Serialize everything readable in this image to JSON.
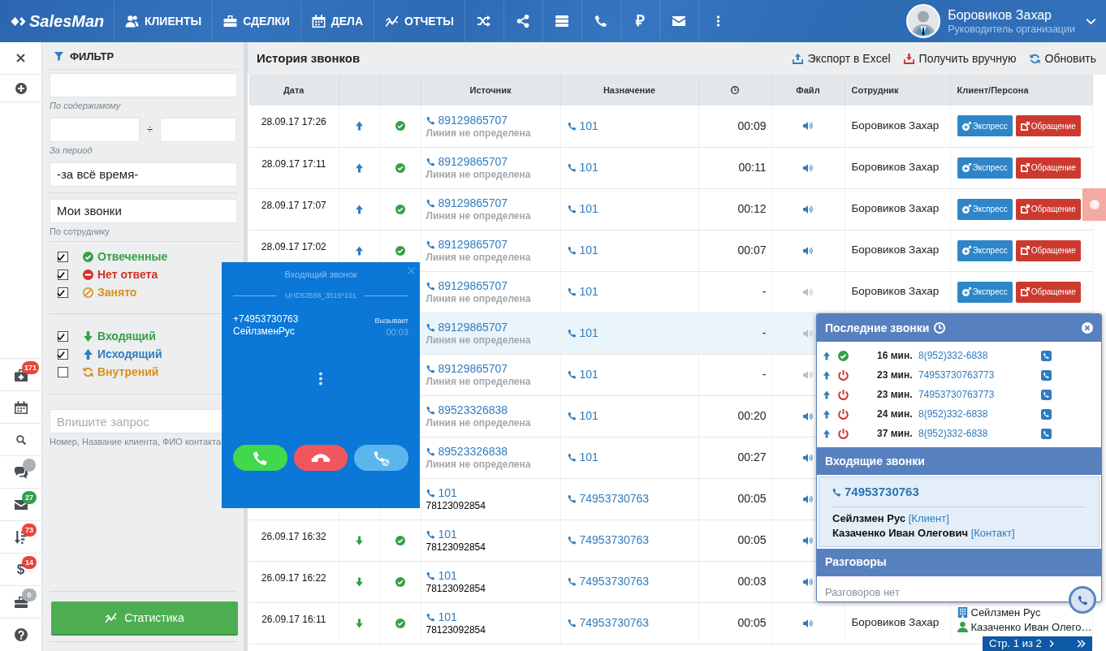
{
  "navbar": {
    "logo": "SalesMan",
    "menu": [
      {
        "label": "КЛИЕНТЫ"
      },
      {
        "label": "СДЕЛКИ"
      },
      {
        "label": "ДЕЛА"
      },
      {
        "label": "ОТЧЕТЫ"
      }
    ],
    "currency": "₽",
    "user": {
      "name": "Боровиков Захар",
      "role": "Руководитель организации"
    }
  },
  "rail": {
    "badges": [
      {
        "text": "171",
        "color": "#e8443a"
      },
      {
        "color": "#a7b1b8"
      },
      {
        "text": "27",
        "color": "#2fa150"
      },
      {
        "text": "73",
        "color": "#e8443a"
      },
      {
        "text": "14",
        "color": "#e8443a"
      },
      {
        "text": "0",
        "color": "#a7b1b8"
      }
    ],
    "currency": "$"
  },
  "filter": {
    "title": "ФИЛЬТР",
    "content": {
      "hint": "По содержимому"
    },
    "period": {
      "separator": "÷",
      "hint": "За период",
      "preset": "-за всё время-"
    },
    "employee": {
      "value": "Мои звонки",
      "hint": "По сотруднику"
    },
    "status_options": [
      {
        "label": "Отвеченные",
        "kind": "answered",
        "checked": true
      },
      {
        "label": "Нет ответа",
        "kind": "no_answer",
        "checked": true
      },
      {
        "label": "Занято",
        "kind": "busy",
        "checked": true
      }
    ],
    "direction_options": [
      {
        "label": "Входящий",
        "kind": "incoming",
        "checked": true
      },
      {
        "label": "Исходящий",
        "kind": "outgoing",
        "checked": true
      },
      {
        "label": "Внутрений",
        "kind": "internal",
        "checked": false
      }
    ],
    "query": {
      "placeholder": "Впишите запрос",
      "hint": "Номер, Название клиента, ФИО контакта"
    },
    "button": "Статистика"
  },
  "calls": {
    "title": "История звонков",
    "actions": [
      {
        "kind": "export",
        "label": "Экспорт в Excel"
      },
      {
        "kind": "fetch",
        "label": "Получить вручную"
      },
      {
        "kind": "refresh",
        "label": "Обновить"
      }
    ],
    "columns": [
      {
        "kind": "text",
        "label": "Дата"
      },
      {
        "kind": "blank"
      },
      {
        "kind": "blank"
      },
      {
        "kind": "text",
        "label": "Источник"
      },
      {
        "kind": "text",
        "label": "Назначение"
      },
      {
        "kind": "clock"
      },
      {
        "kind": "text",
        "label": "Файл"
      },
      {
        "kind": "text",
        "label": "Сотрудник"
      },
      {
        "kind": "text",
        "label": "Клиент/Персона"
      }
    ],
    "rows": [
      {
        "date": "28.09.17 17:26",
        "incoming": false,
        "answered": true,
        "source": {
          "kind": "external",
          "number": "89129865707",
          "line": "Линия не определена"
        },
        "destination": "101",
        "duration": "00:09",
        "recording": true,
        "employee": "Боровиков Захар",
        "actions": [
          {
            "kind": "express",
            "label": "Экспресс"
          },
          {
            "kind": "request",
            "label": "Обращение"
          }
        ],
        "selected": false
      },
      {
        "date": "28.09.17 17:11",
        "incoming": false,
        "answered": true,
        "source": {
          "kind": "external",
          "number": "89129865707",
          "line": "Линия не определена"
        },
        "destination": "101",
        "duration": "00:11",
        "recording": true,
        "employee": "Боровиков Захар",
        "actions": [
          {
            "kind": "express",
            "label": "Экспресс"
          },
          {
            "kind": "request",
            "label": "Обращение"
          }
        ],
        "selected": false
      },
      {
        "date": "28.09.17 17:07",
        "incoming": false,
        "answered": true,
        "source": {
          "kind": "external",
          "number": "89129865707",
          "line": "Линия не определена"
        },
        "destination": "101",
        "duration": "00:12",
        "recording": true,
        "employee": "Боровиков Захар",
        "actions": [
          {
            "kind": "express",
            "label": "Экспресс"
          },
          {
            "kind": "request",
            "label": "Обращение"
          }
        ],
        "selected": false
      },
      {
        "date": "28.09.17 17:02",
        "incoming": false,
        "answered": true,
        "source": {
          "kind": "external",
          "number": "89129865707",
          "line": "Линия не определена"
        },
        "destination": "101",
        "duration": "00:07",
        "recording": true,
        "employee": "Боровиков Захар",
        "actions": [
          {
            "kind": "express",
            "label": "Экспресс"
          },
          {
            "kind": "request",
            "label": "Обращение"
          }
        ],
        "selected": false
      },
      {
        "source": {
          "kind": "external",
          "number": "89129865707",
          "line": "Линия не определена"
        },
        "destination": "101",
        "duration": "-",
        "recording": false,
        "employee": "Боровиков Захар",
        "actions": [
          {
            "kind": "express",
            "label": "Экспресс"
          },
          {
            "kind": "request",
            "label": "Обращение"
          }
        ],
        "selected": false
      },
      {
        "source": {
          "kind": "external",
          "number": "89129865707",
          "line": "Линия не определена"
        },
        "destination": "101",
        "duration": "-",
        "recording": false,
        "selected": true
      },
      {
        "source": {
          "kind": "external",
          "number": "89129865707",
          "line": "Линия не определена"
        },
        "destination": "101",
        "duration": "-",
        "recording": false,
        "selected": false
      },
      {
        "source": {
          "kind": "external",
          "number": "89523326838",
          "line": "Линия не определена"
        },
        "destination": "101",
        "duration": "00:20",
        "recording": true,
        "selected": false
      },
      {
        "source": {
          "kind": "external",
          "number": "89523326838",
          "line": "Линия не определена"
        },
        "destination": "101",
        "duration": "00:27",
        "recording": true,
        "selected": false
      },
      {
        "source": {
          "kind": "internal",
          "number": "101",
          "line": "78123092854"
        },
        "destination": "74953730763",
        "duration": "00:05",
        "recording": true,
        "selected": false
      },
      {
        "date": "26.09.17 16:32",
        "incoming": true,
        "answered": true,
        "source": {
          "kind": "internal",
          "number": "101",
          "line": "78123092854"
        },
        "destination": "74953730763",
        "duration": "00:05",
        "recording": true,
        "selected": false
      },
      {
        "date": "26.09.17 16:22",
        "incoming": true,
        "answered": true,
        "source": {
          "kind": "internal",
          "number": "101",
          "line": "78123092854"
        },
        "destination": "74953730763",
        "duration": "00:03",
        "recording": true,
        "selected": false
      },
      {
        "date": "26.09.17 16:11",
        "incoming": true,
        "answered": true,
        "source": {
          "kind": "internal",
          "number": "101",
          "line": "78123092854"
        },
        "destination": "74953730763",
        "duration": "00:05",
        "recording": true,
        "employee": "Боровиков Захар",
        "persons": [
          {
            "kind": "company",
            "name": "Сейлзмен Рус"
          },
          {
            "kind": "contact",
            "name": "Казаченко Иван Олего…"
          }
        ],
        "selected": false
      }
    ]
  },
  "incoming_call": {
    "title": "Входящий звонок",
    "line": "UHD53588_3515*101",
    "number": "+74953730763",
    "caller": "СейлзменРус",
    "state": "Вызывает",
    "timer": "00:03",
    "buttons": [
      {
        "kind": "answer"
      },
      {
        "kind": "decline"
      },
      {
        "kind": "redirect"
      }
    ]
  },
  "recent_calls": {
    "title": "Последние звонки",
    "items": [
      {
        "incoming": false,
        "answered": true,
        "ago": "16 мин.",
        "number": "8(952)332-6838"
      },
      {
        "incoming": false,
        "answered": false,
        "ago": "23 мин.",
        "number": "74953730763773"
      },
      {
        "incoming": false,
        "answered": false,
        "ago": "23 мин.",
        "number": "74953730763773"
      },
      {
        "incoming": false,
        "answered": false,
        "ago": "24 мин.",
        "number": "8(952)332-6838"
      },
      {
        "incoming": false,
        "answered": false,
        "ago": "37 мин.",
        "number": "8(952)332-6838"
      }
    ],
    "incoming": {
      "title": "Входящие звонки",
      "number": "74953730763",
      "persons": [
        {
          "name": "Сейлзмен Рус",
          "role": "[Клиент]"
        },
        {
          "name": "Казаченко Иван Олегович",
          "role": "[Контакт]"
        }
      ]
    },
    "conversations": {
      "title": "Разговоры",
      "empty_text": "Разговоров нет"
    }
  },
  "pagination": {
    "label": "Стр. 1 из 2"
  }
}
